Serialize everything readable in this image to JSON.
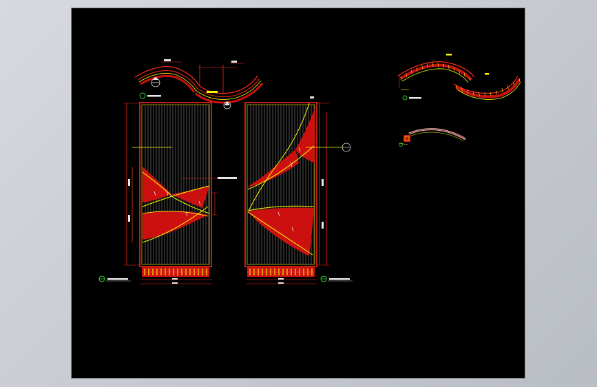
{
  "colors": {
    "background": "#000000",
    "frame": "#ff2a1a",
    "fill": "#cc1010",
    "accent": "#ffff00",
    "grid": "#bdbdbd",
    "label": "#e8e8e8",
    "marker": "#40ff40"
  },
  "icons": [
    "section-marker-icon",
    "north-arrow-icon"
  ]
}
